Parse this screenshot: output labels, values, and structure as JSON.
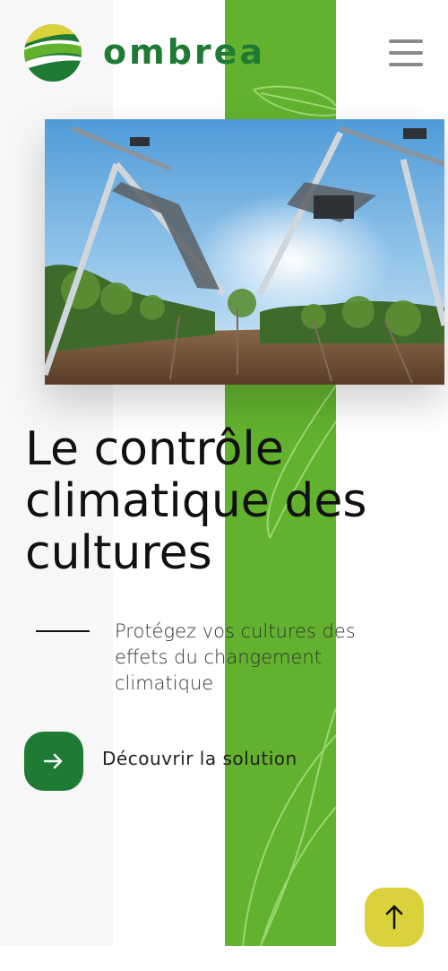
{
  "header": {
    "brand_name": "ombrea",
    "menu_icon": "hamburger-menu-icon"
  },
  "hero": {
    "title": "Le contrôle climatique des cultures",
    "subtitle": "Protégez vos cultures des effets du changement climatique",
    "cta_label": "Découvrir la solution",
    "cta_icon": "arrow-right-icon"
  },
  "scroll_top_icon": "arrow-up-icon",
  "colors": {
    "brand_green": "#1f7a34",
    "accent_green": "#62b22f",
    "accent_yellow": "#d9d23b"
  }
}
